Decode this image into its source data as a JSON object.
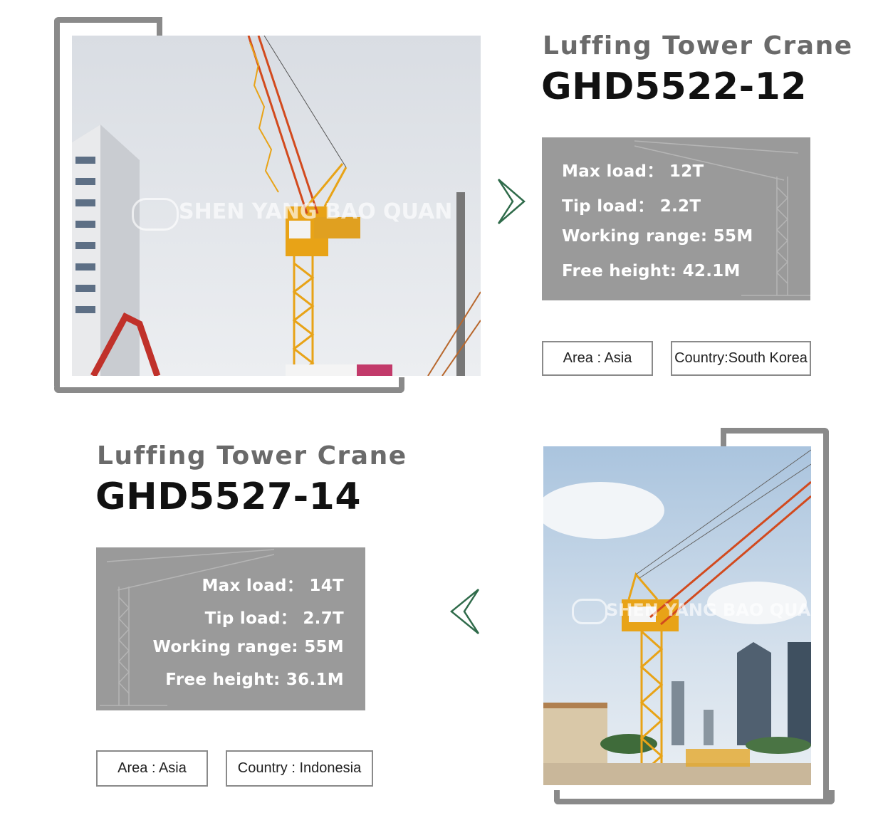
{
  "product1": {
    "subtitle": "Luffing Tower Crane",
    "model": "GHD5522-12",
    "specs": {
      "max_load": "Max load： 12T",
      "tip_load": "Tip load： 2.2T",
      "working_range": "Working range: 55M",
      "free_height": "Free height: 42.1M"
    },
    "area": "Area : Asia",
    "country": "Country:South Korea",
    "watermark": "SHEN YANG BAO QUAN"
  },
  "product2": {
    "subtitle": "Luffing Tower Crane",
    "model": "GHD5527-14",
    "specs": {
      "max_load": "Max load： 14T",
      "tip_load": "Tip load：  2.7T",
      "working_range": "Working range: 55M",
      "free_height": "Free height: 36.1M"
    },
    "area": "Area : Asia",
    "country": "Country : Indonesia",
    "watermark": "SHEN YANG BAO QUAN"
  },
  "icons": {
    "arrow_right": "chevron-right-icon",
    "arrow_left": "chevron-left-icon",
    "watermark_logo": "bq-logo-icon"
  },
  "colors": {
    "frame": "#8a8a8a",
    "spec_box": "#9a9a9a",
    "chevron": "#2f6b4a",
    "crane_yellow": "#e8a317",
    "crane_red": "#c9482a"
  }
}
